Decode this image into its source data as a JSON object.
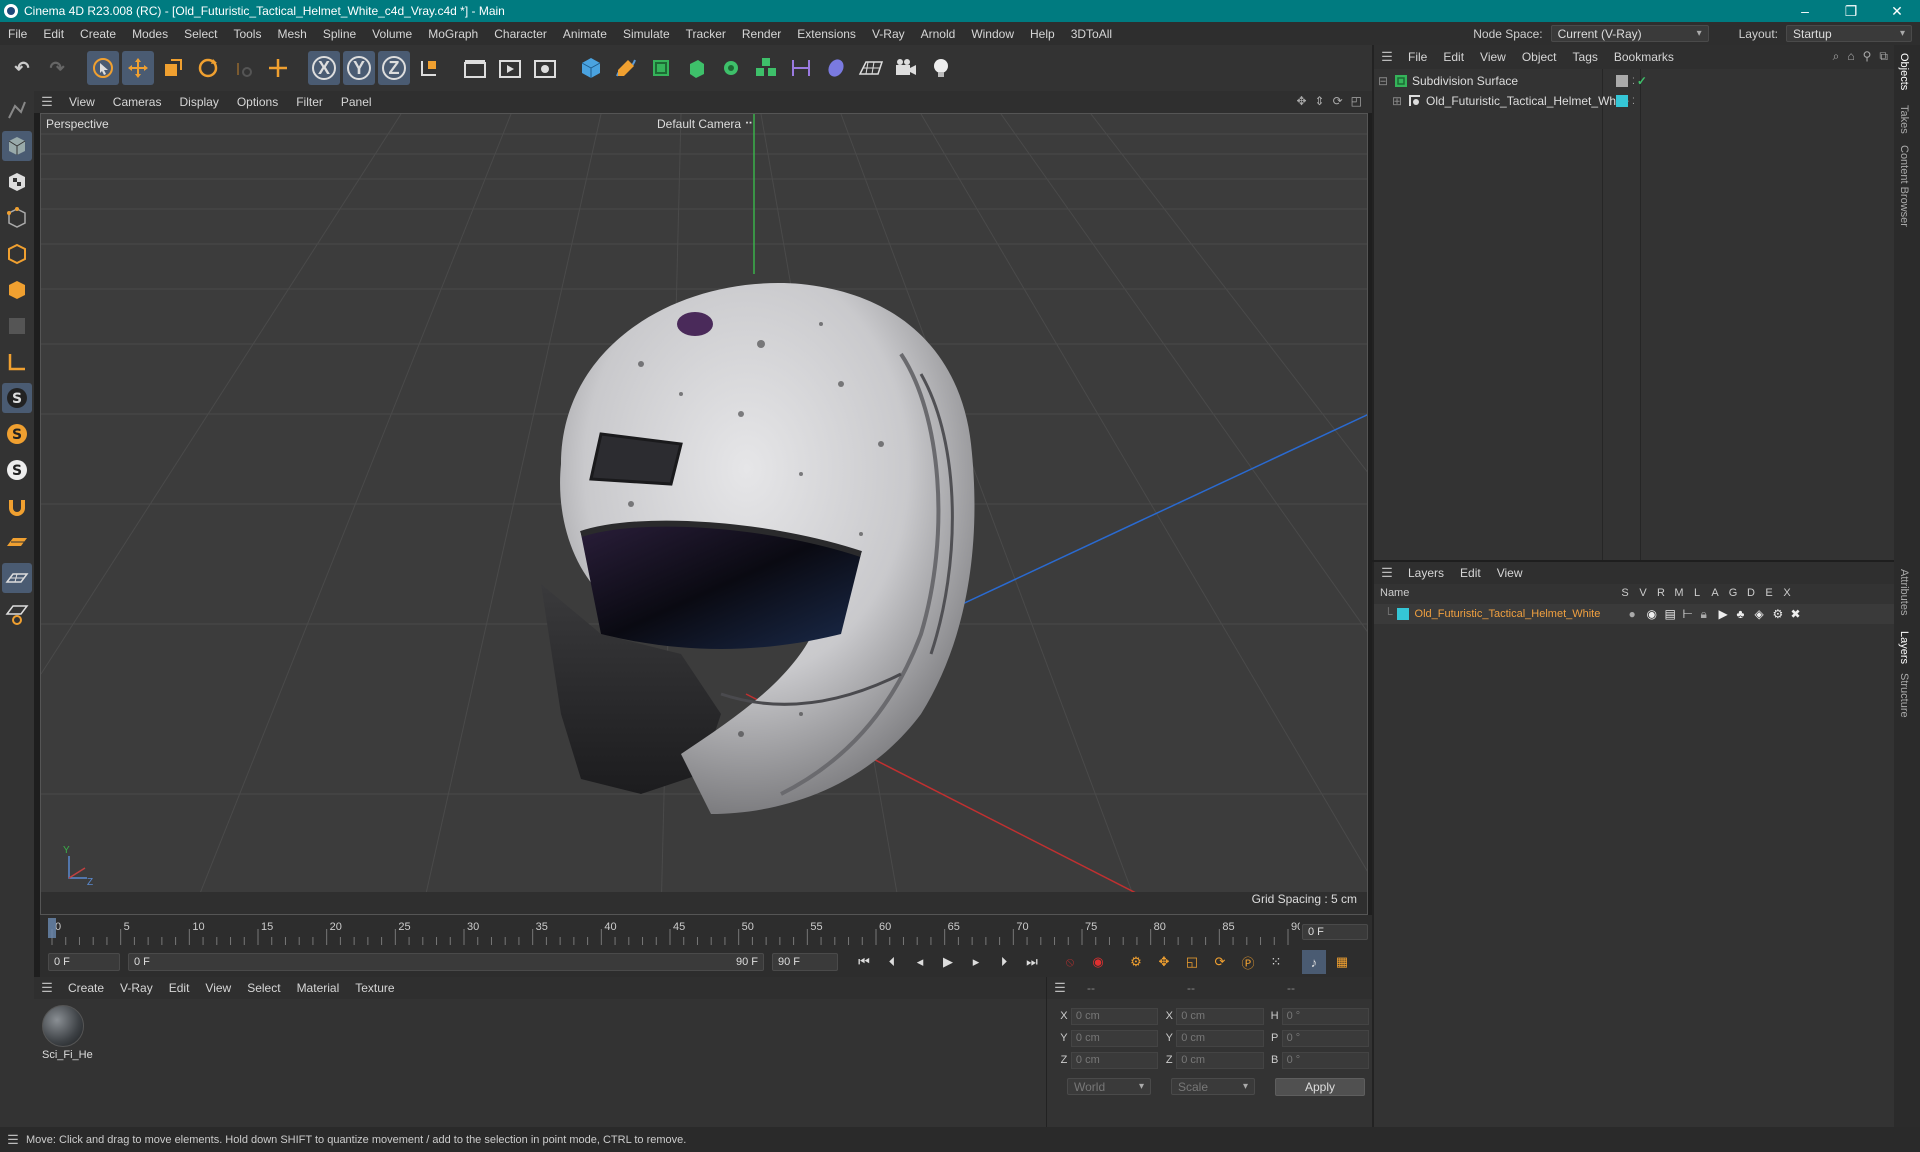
{
  "window": {
    "title": "Cinema 4D R23.008 (RC) - [Old_Futuristic_Tactical_Helmet_White_c4d_Vray.c4d *] - Main",
    "minimize": "–",
    "maximize": "❐",
    "close": "✕"
  },
  "menubar": {
    "items": [
      "File",
      "Edit",
      "Create",
      "Modes",
      "Select",
      "Tools",
      "Mesh",
      "Spline",
      "Volume",
      "MoGraph",
      "Character",
      "Animate",
      "Simulate",
      "Tracker",
      "Render",
      "Extensions",
      "V-Ray",
      "Arnold",
      "Window",
      "Help",
      "3DToAll"
    ],
    "node_space_label": "Node Space:",
    "node_space_value": "Current (V-Ray)",
    "layout_label": "Layout:",
    "layout_value": "Startup"
  },
  "toolbar": {
    "undo": "↶",
    "redo": "↷",
    "axis_x": "X",
    "axis_y": "Y",
    "axis_z": "Z"
  },
  "viewport": {
    "menu": [
      "View",
      "Cameras",
      "Display",
      "Options",
      "Filter",
      "Panel"
    ],
    "label": "Perspective",
    "camera": "Default Camera",
    "grid_spacing": "Grid Spacing : 5 cm",
    "axis_y": "Y",
    "axis_z": "Z"
  },
  "timeline": {
    "ticks": [
      "0",
      "5",
      "10",
      "15",
      "20",
      "25",
      "30",
      "35",
      "40",
      "45",
      "50",
      "55",
      "60",
      "65",
      "70",
      "75",
      "80",
      "85",
      "90"
    ],
    "current_frame": "0 F",
    "start_frame": "0 F",
    "range_start": "0 F",
    "range_end": "90 F",
    "end_frame": "90 F"
  },
  "materials": {
    "menu": [
      "Create",
      "V-Ray",
      "Edit",
      "View",
      "Select",
      "Material",
      "Texture"
    ],
    "items": [
      {
        "label": "Sci_Fi_He"
      }
    ]
  },
  "coordinates": {
    "header": [
      "--",
      "--",
      "--"
    ],
    "rows": [
      {
        "a": "X",
        "av": "0 cm",
        "b": "X",
        "bv": "0 cm",
        "c": "H",
        "cv": "0 °"
      },
      {
        "a": "Y",
        "av": "0 cm",
        "b": "Y",
        "bv": "0 cm",
        "c": "P",
        "cv": "0 °"
      },
      {
        "a": "Z",
        "av": "0 cm",
        "b": "Z",
        "bv": "0 cm",
        "c": "B",
        "cv": "0 °"
      }
    ],
    "mode": "World",
    "transform": "Scale",
    "apply": "Apply"
  },
  "objects": {
    "menu": [
      "File",
      "Edit",
      "View",
      "Object",
      "Tags",
      "Bookmarks"
    ],
    "items": [
      {
        "name": "Subdivision Surface"
      },
      {
        "name": "Old_Futuristic_Tactical_Helmet_White"
      }
    ]
  },
  "layers": {
    "menu": [
      "Layers",
      "Edit",
      "View"
    ],
    "columns": [
      "Name",
      "S",
      "V",
      "R",
      "M",
      "L",
      "A",
      "G",
      "D",
      "E",
      "X"
    ],
    "items": [
      {
        "name": "Old_Futuristic_Tactical_Helmet_White"
      }
    ],
    "layer_color": "#35c6d6"
  },
  "side_tabs": [
    "Objects",
    "Takes",
    "Content Browser",
    "Attributes",
    "Layers",
    "Structure"
  ],
  "status": "Move: Click and drag to move elements. Hold down SHIFT to quantize movement / add to the selection in point mode, CTRL to remove.",
  "colors": {
    "accent": "#007b80",
    "selection": "#4a5b72",
    "layer_text": "#f0a040"
  }
}
